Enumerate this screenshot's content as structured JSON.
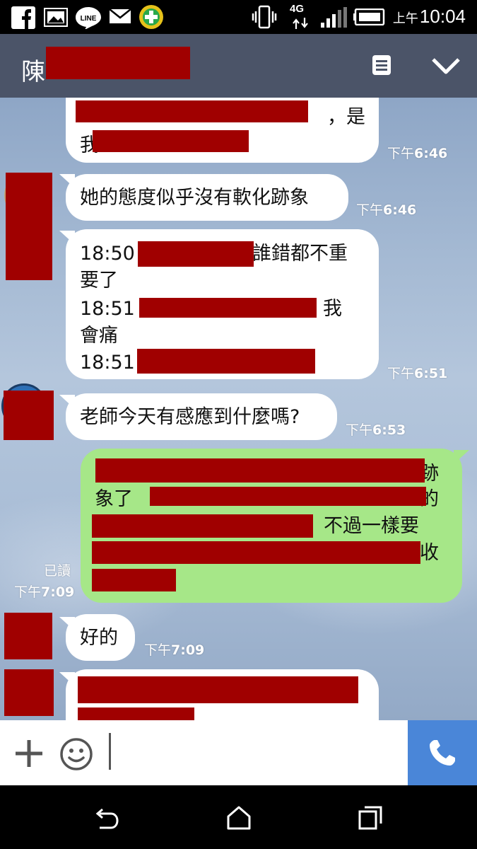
{
  "status_bar": {
    "notification_icons": [
      "facebook-icon",
      "gallery-icon",
      "line-icon",
      "mail-icon",
      "app-plus-icon"
    ],
    "network": "4G",
    "clock_prefix": "上午",
    "clock_time": "10:04"
  },
  "header": {
    "contact_name": "陳"
  },
  "messages": [
    {
      "side": "left",
      "lines": [
        "，是",
        "我"
      ],
      "time_prefix": "下午",
      "time": "6:46"
    },
    {
      "side": "left",
      "lines": [
        "她的態度似乎沒有軟化跡象"
      ],
      "time_prefix": "下午",
      "time": "6:46"
    },
    {
      "side": "left",
      "lines": [
        "18:50",
        "誰錯都不重",
        "要了",
        "18:51",
        "我",
        "會痛",
        "18:51"
      ],
      "time_prefix": "下午",
      "time": "6:51"
    },
    {
      "side": "left",
      "lines": [
        "老師今天有感應到什麼嗎?"
      ],
      "time_prefix": "下午",
      "time": "6:53"
    },
    {
      "side": "right",
      "lines": [
        "跡",
        "象了",
        "的",
        "不過一樣要",
        "收"
      ],
      "read_label": "已讀",
      "time_prefix": "下午",
      "time": "7:09"
    },
    {
      "side": "left",
      "lines": [
        "好的"
      ],
      "time_prefix": "下午",
      "time": "7:09"
    }
  ],
  "colors": {
    "header_bg": "#4b5468",
    "own_bubble": "#a6e788",
    "other_bubble": "#ffffff",
    "redaction": "#a00000",
    "call_button": "#4a86d8"
  }
}
